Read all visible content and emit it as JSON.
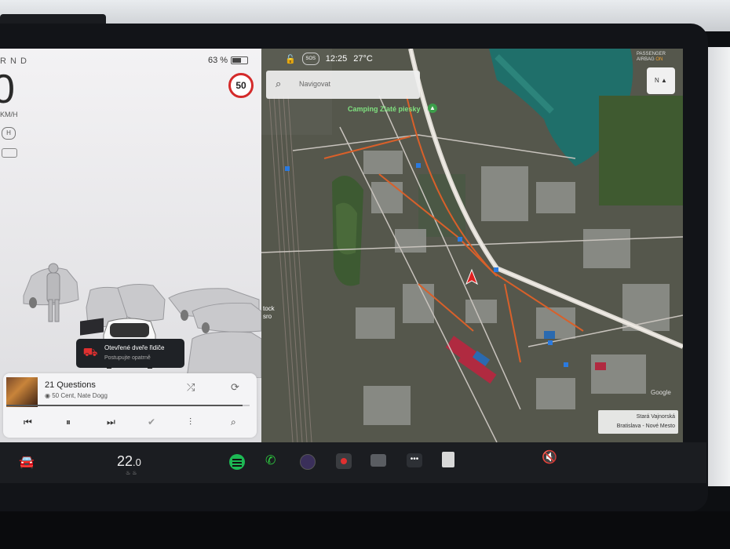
{
  "left_panel": {
    "gear": "R N D",
    "battery": "63 %",
    "speed": "0",
    "speed_unit": "KM/H",
    "speed_limit": "50",
    "alert": {
      "title": "Otevřené dveře řidiče",
      "subtitle": "Postupujte opatrně"
    }
  },
  "media": {
    "song": "21 Questions",
    "artist": "50 Cent, Nate Dogg",
    "progress": 0.97
  },
  "map": {
    "time": "12:25",
    "temperature": "27°C",
    "sos": "SOS",
    "search_placeholder": "Navigovat",
    "airbag_line1": "PASSENGER",
    "airbag_line2": "AIRBAG",
    "airbag_state": "ON",
    "poi_label": "Camping Zlaté piesky",
    "partial_label_1": "tock",
    "partial_label_2": "sro",
    "location_line1": "Stará Vajnorská",
    "location_line2": "Bratislava - Nové Mesto",
    "attribution": "Google"
  },
  "bottom_bar": {
    "temperature": "22",
    "temperature_decimal": ".0"
  },
  "colors": {
    "speed_limit_ring": "#d42a2a",
    "spotify_green": "#1db954",
    "phone_green": "#2ecc40",
    "nav_arrow": "#e02020",
    "airbag_on": "#f0a030"
  }
}
